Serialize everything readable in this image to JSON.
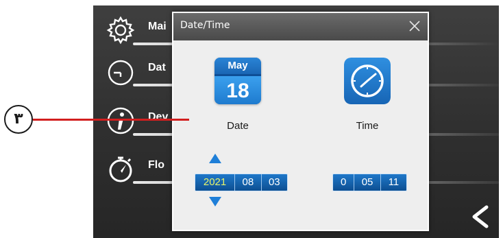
{
  "menu": {
    "items": [
      {
        "label": "Mai",
        "icon": "gear-icon"
      },
      {
        "label": "Dat",
        "icon": "clock-outline-icon"
      },
      {
        "label": "Dev",
        "icon": "info-icon"
      },
      {
        "label": "Flo",
        "icon": "stopwatch-icon"
      }
    ],
    "back_icon": "chevron-left-icon"
  },
  "dialog": {
    "title": "Date/Time",
    "close_icon": "close-icon",
    "date": {
      "label": "Date",
      "calendar_month": "May",
      "calendar_day": "18",
      "year": "2021",
      "month": "08",
      "day": "03"
    },
    "time": {
      "label": "Time",
      "hour": "0",
      "minute": "05",
      "second": "11"
    }
  },
  "annotation": {
    "number": "۳"
  },
  "colors": {
    "accent_blue": "#1f78c9",
    "active_value": "#e8f56a",
    "callout_line": "#d21f1f"
  }
}
